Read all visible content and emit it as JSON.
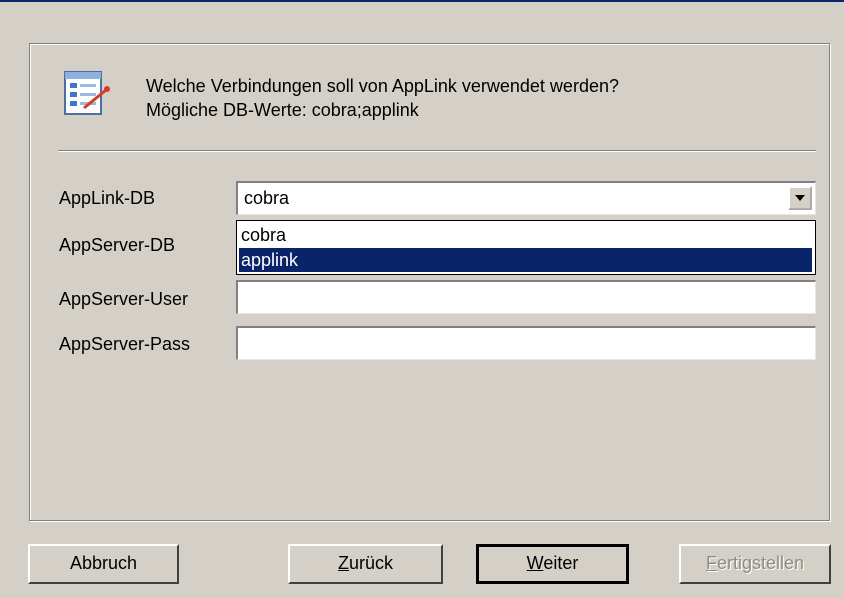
{
  "header": {
    "question_line1": "Welche Verbindungen soll von AppLink verwendet werden?",
    "question_line2": "Mögliche DB-Werte: cobra;applink",
    "icon": "form-list-icon"
  },
  "form": {
    "applink_db": {
      "label": "AppLink-DB",
      "value": "cobra"
    },
    "appserver_db": {
      "label": "AppServer-DB",
      "value": ""
    },
    "appserver_user": {
      "label": "AppServer-User",
      "value": ""
    },
    "appserver_pass": {
      "label": "AppServer-Pass",
      "value": ""
    }
  },
  "dropdown": {
    "options": [
      "cobra",
      "applink"
    ],
    "selected_index": 1
  },
  "buttons": {
    "cancel": "Abbruch",
    "back": {
      "mnemonic": "Z",
      "rest": "urück"
    },
    "next": {
      "mnemonic": "W",
      "rest": "eiter"
    },
    "finish": {
      "mnemonic": "F",
      "rest": "ertigstellen"
    }
  },
  "colors": {
    "dialog_bg": "#d4d0c8",
    "selection": "#0a246a"
  }
}
